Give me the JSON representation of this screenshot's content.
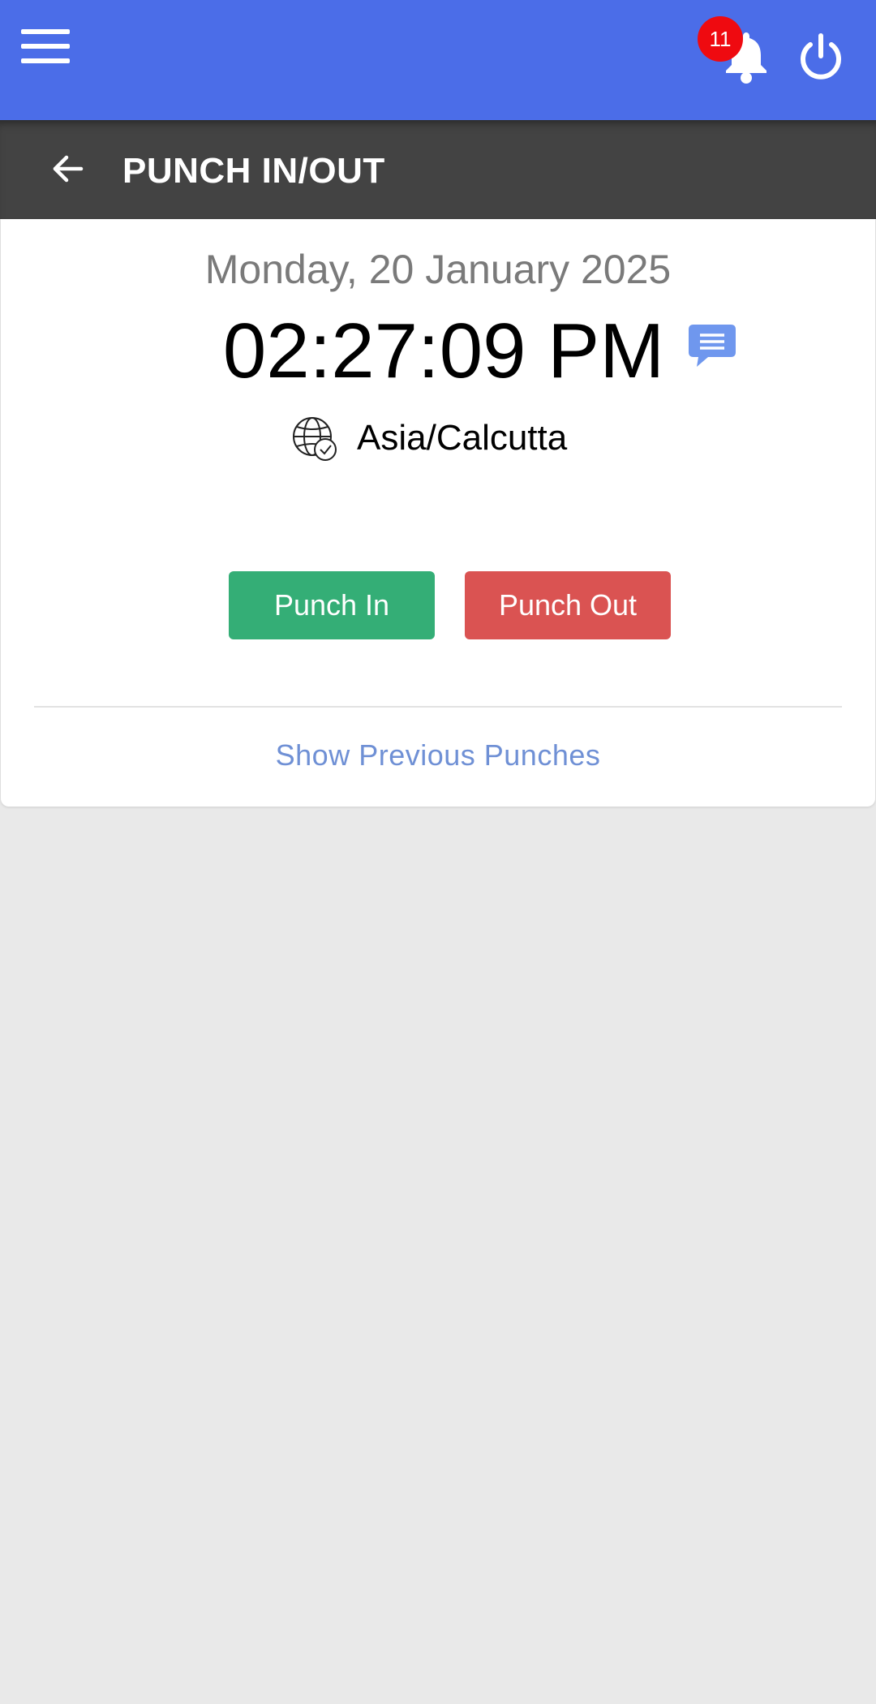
{
  "header": {
    "menu_icon": "hamburger-menu-icon",
    "notifications": {
      "icon": "bell-icon",
      "count": "11"
    },
    "power_icon": "power-icon",
    "bg_color": "#4b6de8"
  },
  "subheader": {
    "back_icon": "arrow-left-icon",
    "title": "PUNCH IN/OUT",
    "bg_color": "#434343"
  },
  "clock": {
    "date": "Monday, 20 January 2025",
    "time": "02:27:09 PM",
    "note_icon": "chat-bubble-icon",
    "timezone_icon": "globe-clock-icon",
    "timezone": "Asia/Calcutta"
  },
  "actions": {
    "punch_in_label": "Punch In",
    "punch_in_color": "#34ae76",
    "punch_out_label": "Punch Out",
    "punch_out_color": "#da5352"
  },
  "history": {
    "link_label": "Show Previous Punches",
    "link_color": "#6f90d5"
  }
}
